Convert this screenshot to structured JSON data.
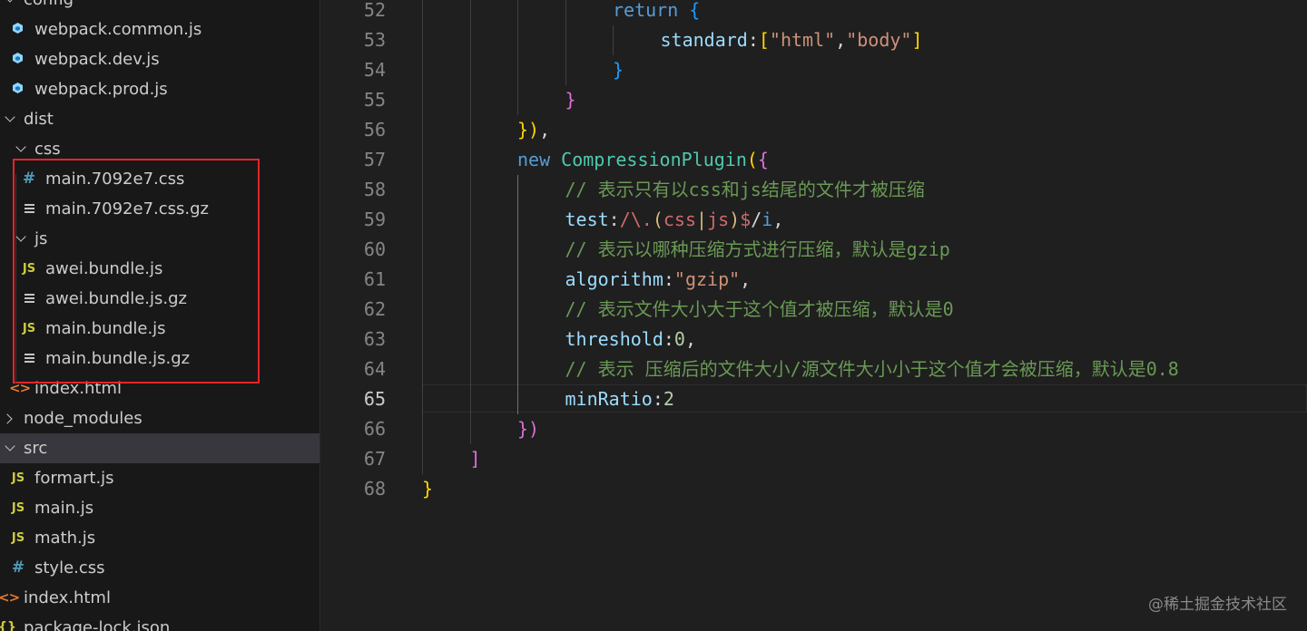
{
  "explorer": {
    "items": [
      {
        "label": "config",
        "type": "folder",
        "open": true,
        "depth": 0
      },
      {
        "label": "webpack.common.js",
        "type": "webpack",
        "depth": 1
      },
      {
        "label": "webpack.dev.js",
        "type": "webpack",
        "depth": 1
      },
      {
        "label": "webpack.prod.js",
        "type": "webpack",
        "depth": 1
      },
      {
        "label": "dist",
        "type": "folder",
        "open": true,
        "depth": 0
      },
      {
        "label": "css",
        "type": "folder",
        "open": true,
        "depth": 1
      },
      {
        "label": "main.7092e7.css",
        "type": "css",
        "depth": 2
      },
      {
        "label": "main.7092e7.css.gz",
        "type": "gz",
        "depth": 2
      },
      {
        "label": "js",
        "type": "folder",
        "open": true,
        "depth": 1
      },
      {
        "label": "awei.bundle.js",
        "type": "js",
        "depth": 2
      },
      {
        "label": "awei.bundle.js.gz",
        "type": "gz",
        "depth": 2
      },
      {
        "label": "main.bundle.js",
        "type": "js",
        "depth": 2
      },
      {
        "label": "main.bundle.js.gz",
        "type": "gz",
        "depth": 2
      },
      {
        "label": "index.html",
        "type": "html",
        "depth": 1
      },
      {
        "label": "node_modules",
        "type": "folder",
        "open": false,
        "depth": 0
      },
      {
        "label": "src",
        "type": "folder",
        "open": true,
        "depth": 0,
        "active": true
      },
      {
        "label": "formart.js",
        "type": "js",
        "depth": 1
      },
      {
        "label": "main.js",
        "type": "js",
        "depth": 1
      },
      {
        "label": "math.js",
        "type": "js",
        "depth": 1
      },
      {
        "label": "style.css",
        "type": "css",
        "depth": 1
      },
      {
        "label": "index.html",
        "type": "html",
        "depth": 0
      },
      {
        "label": "package-lock.json",
        "type": "json",
        "depth": 0
      }
    ],
    "icons": {
      "js": "JS",
      "css": "#",
      "html": "<>",
      "json": "{}"
    }
  },
  "editor": {
    "current_line": 65,
    "lines": [
      {
        "n": 52,
        "indent": 4,
        "tokens": [
          [
            "k",
            "return"
          ],
          [
            "op",
            " "
          ],
          [
            "b3",
            "{"
          ]
        ]
      },
      {
        "n": 53,
        "indent": 5,
        "tokens": [
          [
            "p",
            "standard"
          ],
          [
            "op",
            ":"
          ],
          [
            "b1",
            "["
          ],
          [
            "s",
            "\"html\""
          ],
          [
            "op",
            ","
          ],
          [
            "s",
            "\"body\""
          ],
          [
            "b1",
            "]"
          ]
        ]
      },
      {
        "n": 54,
        "indent": 4,
        "tokens": [
          [
            "b3",
            "}"
          ]
        ]
      },
      {
        "n": 55,
        "indent": 3,
        "tokens": [
          [
            "b2",
            "}"
          ]
        ]
      },
      {
        "n": 56,
        "indent": 2,
        "tokens": [
          [
            "b1",
            "})"
          ],
          [
            "op",
            ","
          ]
        ]
      },
      {
        "n": 57,
        "indent": 2,
        "tokens": [
          [
            "k",
            "new"
          ],
          [
            "op",
            " "
          ],
          [
            "c",
            "CompressionPlugin"
          ],
          [
            "b1",
            "("
          ],
          [
            "b2",
            "{"
          ]
        ]
      },
      {
        "n": 58,
        "indent": 3,
        "tokens": [
          [
            "cm",
            "// 表示只有以css和js结尾的文件才被压缩"
          ]
        ]
      },
      {
        "n": 59,
        "indent": 3,
        "tokens": [
          [
            "p",
            "test"
          ],
          [
            "op",
            ":"
          ],
          [
            "re",
            "/\\."
          ],
          [
            "rc",
            "("
          ],
          [
            "re",
            "css"
          ],
          [
            "rc",
            "|"
          ],
          [
            "re",
            "js"
          ],
          [
            "rc",
            ")"
          ],
          [
            "re",
            "$"
          ],
          [
            "op",
            "/"
          ],
          [
            "k",
            "i"
          ],
          [
            "op",
            ","
          ]
        ]
      },
      {
        "n": 60,
        "indent": 3,
        "tokens": [
          [
            "cm",
            "// 表示以哪种压缩方式进行压缩，默认是gzip"
          ]
        ]
      },
      {
        "n": 61,
        "indent": 3,
        "tokens": [
          [
            "p",
            "algorithm"
          ],
          [
            "op",
            ":"
          ],
          [
            "s",
            "\"gzip\""
          ],
          [
            "op",
            ","
          ]
        ]
      },
      {
        "n": 62,
        "indent": 3,
        "tokens": [
          [
            "cm",
            "// 表示文件大小大于这个值才被压缩，默认是0"
          ]
        ]
      },
      {
        "n": 63,
        "indent": 3,
        "tokens": [
          [
            "p",
            "threshold"
          ],
          [
            "op",
            ":"
          ],
          [
            "n",
            "0"
          ],
          [
            "op",
            ","
          ]
        ]
      },
      {
        "n": 64,
        "indent": 3,
        "tokens": [
          [
            "cm",
            "// 表示 压缩后的文件大小/源文件大小小于这个值才会被压缩，默认是0.8"
          ]
        ]
      },
      {
        "n": 65,
        "indent": 3,
        "tokens": [
          [
            "p",
            "minRatio"
          ],
          [
            "op",
            ":"
          ],
          [
            "n",
            "2"
          ]
        ]
      },
      {
        "n": 66,
        "indent": 2,
        "tokens": [
          [
            "b2",
            "})"
          ]
        ]
      },
      {
        "n": 67,
        "indent": 1,
        "tokens": [
          [
            "b2",
            "]"
          ]
        ]
      },
      {
        "n": 68,
        "indent": 0,
        "tokens": [
          [
            "b1",
            "}"
          ]
        ]
      }
    ]
  },
  "watermark": "@稀土掘金技术社区"
}
